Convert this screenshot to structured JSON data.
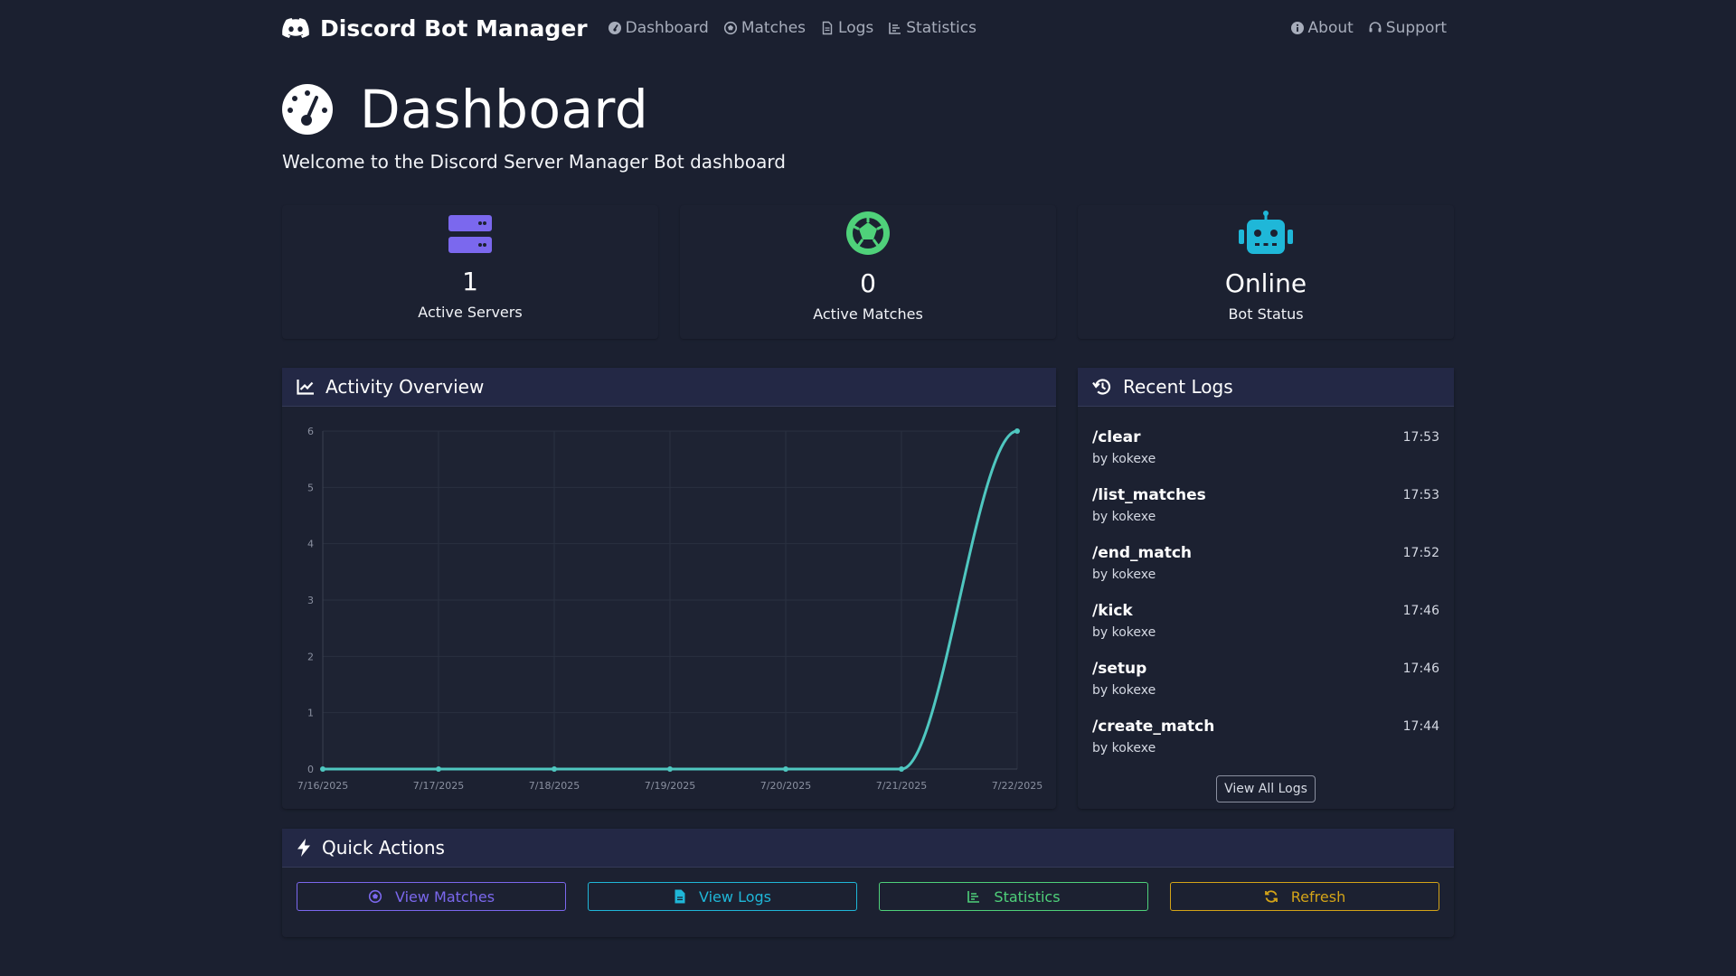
{
  "brand": {
    "name": "Discord Bot Manager"
  },
  "nav": {
    "links": [
      "Dashboard",
      "Matches",
      "Logs",
      "Statistics"
    ],
    "right": [
      "About",
      "Support"
    ]
  },
  "header": {
    "title": "Dashboard",
    "subtitle": "Welcome to the Discord Server Manager Bot dashboard"
  },
  "stats": [
    {
      "value": "1",
      "label": "Active Servers",
      "icon": "server-icon",
      "color": "#7b68ee"
    },
    {
      "value": "0",
      "label": "Active Matches",
      "icon": "futbol-icon",
      "color": "#4fd17a"
    },
    {
      "value": "Online",
      "label": "Bot Status",
      "icon": "robot-icon",
      "color": "#1fb7d8"
    }
  ],
  "activity": {
    "title": "Activity Overview"
  },
  "chart_data": {
    "type": "line",
    "x": [
      "7/16/2025",
      "7/17/2025",
      "7/18/2025",
      "7/19/2025",
      "7/20/2025",
      "7/21/2025",
      "7/22/2025"
    ],
    "series": [
      {
        "values": [
          0,
          0,
          0,
          0,
          0,
          0,
          6
        ],
        "color": "#4fc7c0"
      }
    ],
    "ylim": [
      0,
      6
    ],
    "yticks": [
      0,
      1,
      2,
      3,
      4,
      5,
      6
    ],
    "grid": true,
    "title": "",
    "xlabel": "",
    "ylabel": ""
  },
  "logs": {
    "title": "Recent Logs",
    "items": [
      {
        "command": "/clear",
        "by": "by kokexe",
        "time": "17:53"
      },
      {
        "command": "/list_matches",
        "by": "by kokexe",
        "time": "17:53"
      },
      {
        "command": "/end_match",
        "by": "by kokexe",
        "time": "17:52"
      },
      {
        "command": "/kick",
        "by": "by kokexe",
        "time": "17:46"
      },
      {
        "command": "/setup",
        "by": "by kokexe",
        "time": "17:46"
      },
      {
        "command": "/create_match",
        "by": "by kokexe",
        "time": "17:44"
      }
    ],
    "view_all": "View All Logs"
  },
  "quick_actions": {
    "title": "Quick Actions",
    "buttons": [
      {
        "label": "View Matches",
        "color": "#7b68ee",
        "icon": "futbol-icon"
      },
      {
        "label": "View Logs",
        "color": "#1fb7d8",
        "icon": "file-icon"
      },
      {
        "label": "Statistics",
        "color": "#4fd17a",
        "icon": "chart-bar-icon"
      },
      {
        "label": "Refresh",
        "color": "#d4a418",
        "icon": "refresh-icon"
      }
    ]
  }
}
